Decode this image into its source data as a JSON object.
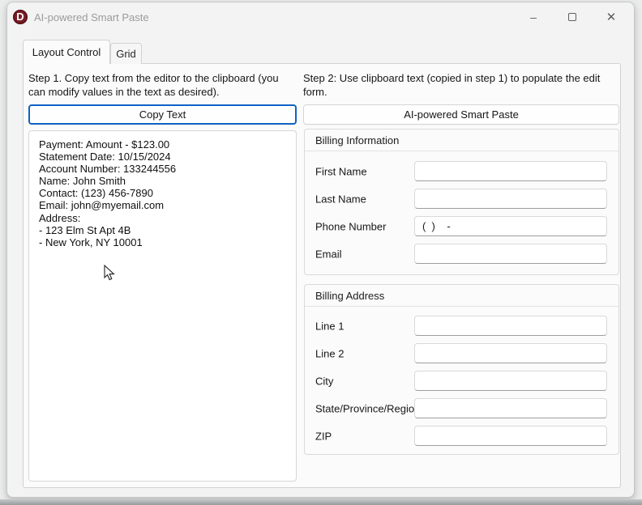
{
  "window": {
    "title": "AI-powered Smart Paste",
    "logo_letter": "D",
    "controls": {
      "minimize": "–",
      "close": "✕"
    }
  },
  "tabs": [
    {
      "label": "Layout Control",
      "active": true
    },
    {
      "label": "Grid",
      "active": false
    }
  ],
  "left": {
    "step_text": "Step 1. Copy text from the editor to the clipboard (you can modify values in the text as desired).",
    "copy_button": "Copy Text",
    "editor_text": "Payment: Amount - $123.00\nStatement Date: 10/15/2024\nAccount Number: 133244556\nName: John Smith\nContact: (123) 456-7890\nEmail: john@myemail.com\nAddress:\n- 123 Elm St Apt 4B\n- New York, NY 10001"
  },
  "right": {
    "step_text": "Step 2: Use clipboard text (copied in step 1) to populate the edit form.",
    "paste_button": "AI-powered Smart Paste",
    "groups": [
      {
        "title": "Billing Information",
        "fields": [
          {
            "label": "First Name",
            "value": ""
          },
          {
            "label": "Last Name",
            "value": ""
          },
          {
            "label": "Phone Number",
            "value": "(  )    -"
          },
          {
            "label": "Email",
            "value": ""
          }
        ]
      },
      {
        "title": "Billing Address",
        "fields": [
          {
            "label": "Line 1",
            "value": ""
          },
          {
            "label": "Line 2",
            "value": ""
          },
          {
            "label": "City",
            "value": ""
          },
          {
            "label": "State/Province/Region",
            "value": ""
          },
          {
            "label": "ZIP",
            "value": ""
          }
        ]
      }
    ]
  },
  "colors": {
    "accent": "#0f63c5",
    "logo_red": "#7d1f28"
  }
}
